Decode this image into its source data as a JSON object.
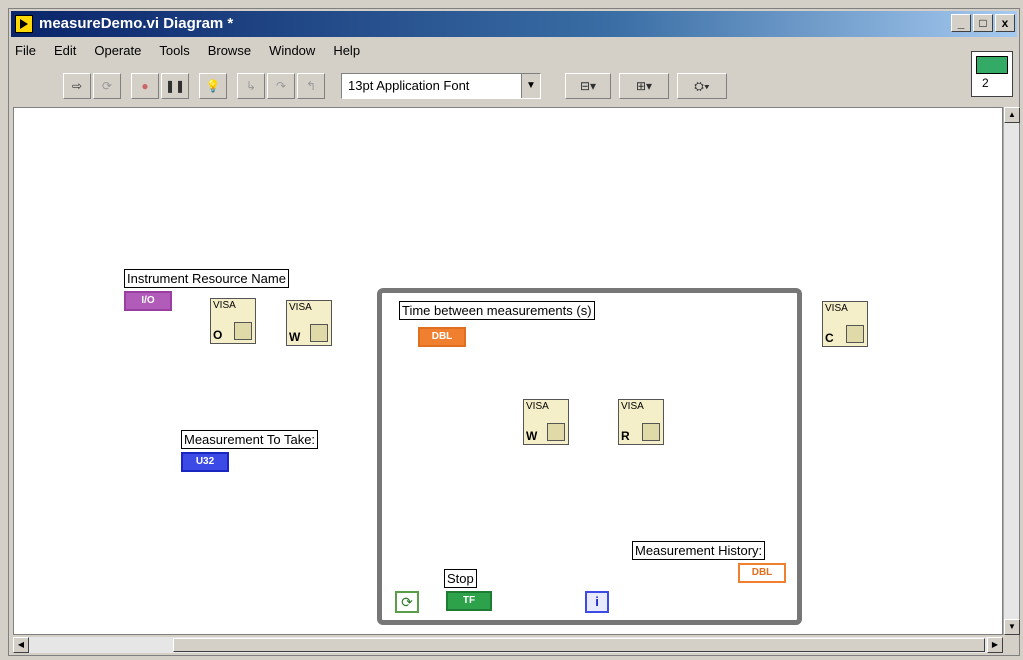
{
  "window": {
    "title": "measureDemo.vi Diagram *",
    "controls": [
      "_",
      "□",
      "x"
    ]
  },
  "menu": [
    "File",
    "Edit",
    "Operate",
    "Tools",
    "Browse",
    "Window",
    "Help"
  ],
  "toolbar": {
    "font": "13pt Application Font"
  },
  "connector_pane": {
    "text": "2"
  },
  "diagram": {
    "labels": {
      "instrument_resource": "Instrument Resource Name",
      "measurement_to_take": "Measurement To Take:",
      "time_between": "Time between measurements (s)",
      "stop": "Stop",
      "history": "Measurement History:"
    },
    "terminals": {
      "resource": "I/O",
      "measurement": "U32",
      "time": "DBL",
      "stop": "TF",
      "history": "DBL"
    },
    "vis": {
      "open": {
        "top": "VISA",
        "bottom": "O"
      },
      "write1": {
        "top": "VISA",
        "bottom": "W"
      },
      "write2": {
        "top": "VISA",
        "bottom": "W"
      },
      "read": {
        "top": "VISA",
        "bottom": "R"
      },
      "close": {
        "top": "VISA",
        "bottom": "C"
      }
    },
    "loop": {
      "iteration": "i"
    }
  }
}
